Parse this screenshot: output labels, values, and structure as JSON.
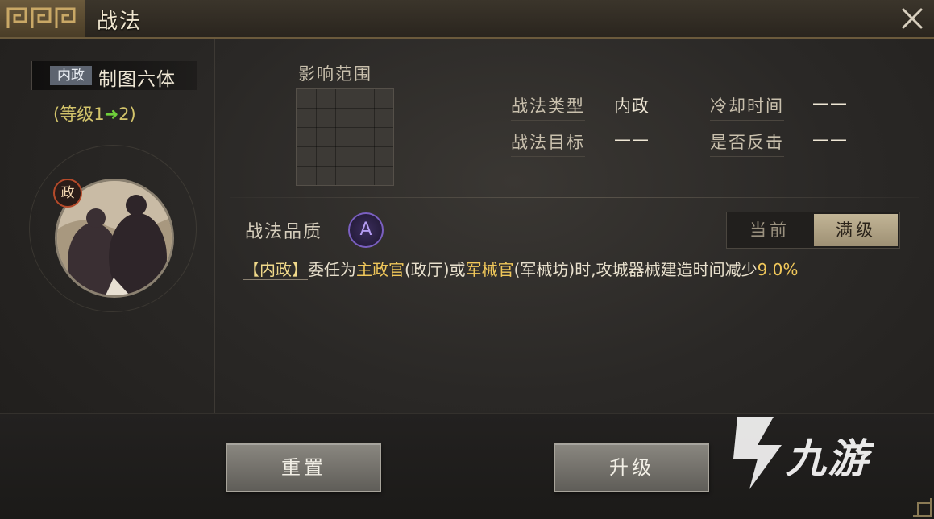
{
  "window": {
    "title": "战法",
    "close_icon": "close-icon"
  },
  "skill": {
    "type_tag": "内政",
    "name": "制图六体",
    "level_prefix": "(等级1",
    "level_arrow": "➜",
    "level_suffix": "2)",
    "portrait_badge": "政"
  },
  "info": {
    "range_label": "影响范围",
    "type_label": "战法类型",
    "type_value": "内政",
    "target_label": "战法目标",
    "target_value": "——",
    "cooldown_label": "冷却时间",
    "cooldown_value": "——",
    "counter_label": "是否反击",
    "counter_value": "——"
  },
  "quality": {
    "label": "战法品质",
    "grade": "A"
  },
  "level_toggle": {
    "current": "当前",
    "max": "满级",
    "selected": "满级"
  },
  "description": {
    "tag": "【内政】",
    "part1": "委任为",
    "role1": "主政官",
    "part2": "(政厅)或",
    "role2": "军械官",
    "part3": "(军械坊)时,攻城器械建造时间减少",
    "value": "9.0%"
  },
  "buttons": {
    "reset": "重置",
    "upgrade": "升级"
  },
  "watermark": {
    "text": "九游"
  },
  "colors": {
    "accent_gold": "#f0c75a",
    "quality_purple": "#7a5fc0",
    "arrow_green": "#6fcf3a",
    "badge_red": "#b54a2a"
  }
}
